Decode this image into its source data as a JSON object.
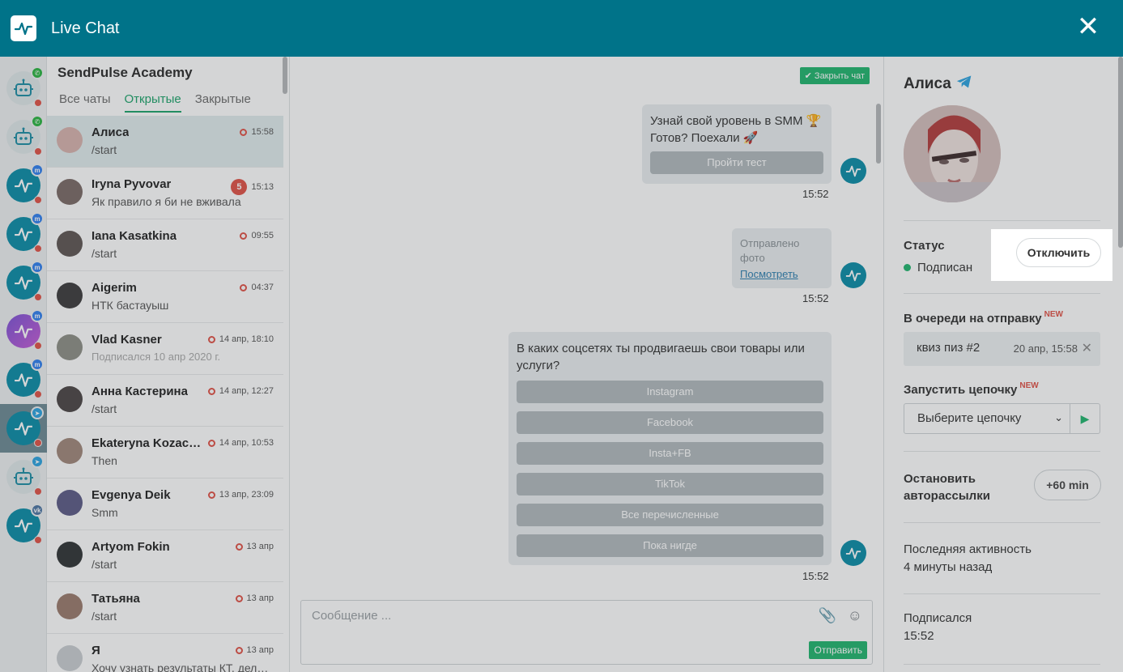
{
  "header": {
    "title": "Live Chat",
    "close_icon": "close-icon"
  },
  "rail": {
    "bots": [
      {
        "kind": "robot",
        "channel": "wa",
        "channel_glyph": "✆"
      },
      {
        "kind": "robot",
        "channel": "wa",
        "channel_glyph": "✆"
      },
      {
        "kind": "pulse",
        "channel": "fb",
        "channel_glyph": "m"
      },
      {
        "kind": "pulse",
        "channel": "fb",
        "channel_glyph": "m"
      },
      {
        "kind": "pulse",
        "channel": "fb",
        "channel_glyph": "m"
      },
      {
        "kind": "purple",
        "channel": "fb",
        "channel_glyph": "m"
      },
      {
        "kind": "pulse",
        "channel": "fb",
        "channel_glyph": "m"
      },
      {
        "kind": "pulse",
        "channel": "tg",
        "channel_glyph": "➤",
        "active": true
      },
      {
        "kind": "robot",
        "channel": "tg",
        "channel_glyph": "➤"
      },
      {
        "kind": "pulse",
        "channel": "vk",
        "channel_glyph": "vk"
      }
    ]
  },
  "list": {
    "account": "SendPulse Academy",
    "tabs": [
      "Все чаты",
      "Открытые",
      "Закрытые"
    ],
    "active_tab": 1,
    "chats": [
      {
        "name": "Алиса",
        "msg": "/start",
        "time": "15:58",
        "selected": true,
        "avatar_color": "#d8b2ad"
      },
      {
        "name": "Iryna Pyvovar",
        "msg": "Як правило я би не вживала",
        "time": "15:13",
        "count": "5",
        "avatar_color": "#7a6a66"
      },
      {
        "name": "Iana Kasatkina",
        "msg": "/start",
        "time": "09:55",
        "avatar_color": "#5e5552"
      },
      {
        "name": "Aigerim",
        "msg": "НТК бастауыш",
        "time": "04:37",
        "avatar_color": "#3c3a3c"
      },
      {
        "name": "Vlad Kasner",
        "msg": "Подписался 10 апр 2020 г.",
        "time": "14 апр, 18:10",
        "faint": true,
        "avatar_color": "#8e8f86"
      },
      {
        "name": "Анна Кастерина",
        "msg": "/start",
        "time": "14 апр, 12:27",
        "avatar_color": "#4b4444"
      },
      {
        "name": "Ekateryna Kozachenko",
        "msg": "Then",
        "time": "14 апр, 10:53",
        "avatar_color": "#a0877a"
      },
      {
        "name": "Evgenya Deik",
        "msg": "Smm",
        "time": "13 апр, 23:09",
        "avatar_color": "#5b5a86"
      },
      {
        "name": "Artyom Fokin",
        "msg": "/start",
        "time": "13 апр",
        "avatar_color": "#2f3234"
      },
      {
        "name": "Татьяна",
        "msg": "/start",
        "time": "13 апр",
        "avatar_color": "#9a7a6c"
      },
      {
        "name": "Я",
        "msg": "Хочу узнать результаты КТ, делала вчера",
        "time": "13 апр",
        "avatar_color": "#c9ced1"
      }
    ]
  },
  "conversation": {
    "close_chat": "Закрыть чат",
    "msg1": {
      "line1": "Узнай свой уровень в SMM 🏆",
      "line2": "Готов? Поехали 🚀",
      "button": "Пройти тест",
      "time": "15:52"
    },
    "msg2": {
      "note": "Отправлено фото",
      "link": "Посмотреть",
      "time": "15:52"
    },
    "msg3": {
      "text": "В каких соцсетях ты продвигаешь свои товары или услуги?",
      "buttons": [
        "Instagram",
        "Facebook",
        "Insta+FB",
        "TikTok",
        "Все перечисленные",
        "Пока нигде"
      ],
      "time": "15:52"
    },
    "compose": {
      "placeholder": "Сообщение ...",
      "send": "Отправить"
    }
  },
  "profile": {
    "name": "Алиса",
    "status_label": "Статус",
    "status_value": "Подписан",
    "disconnect": "Отключить",
    "queue_label": "В очереди на отправку",
    "queue_new": "NEW",
    "queue_item": "квиз пиз #2",
    "queue_time": "20 апр, 15:58",
    "chain_label": "Запустить цепочку",
    "chain_new": "NEW",
    "chain_placeholder": "Выберите цепочку",
    "stop_label_1": "Остановить",
    "stop_label_2": "авторассылки",
    "stop_button": "+60 min",
    "last_activity_label": "Последняя активность",
    "last_activity_value": "4 минуты назад",
    "subscribed_label": "Подписался",
    "subscribed_value": "15:52"
  },
  "colors": {
    "header": "#007389",
    "accent_green": "#1fb56d",
    "alert_red": "#e15146"
  }
}
